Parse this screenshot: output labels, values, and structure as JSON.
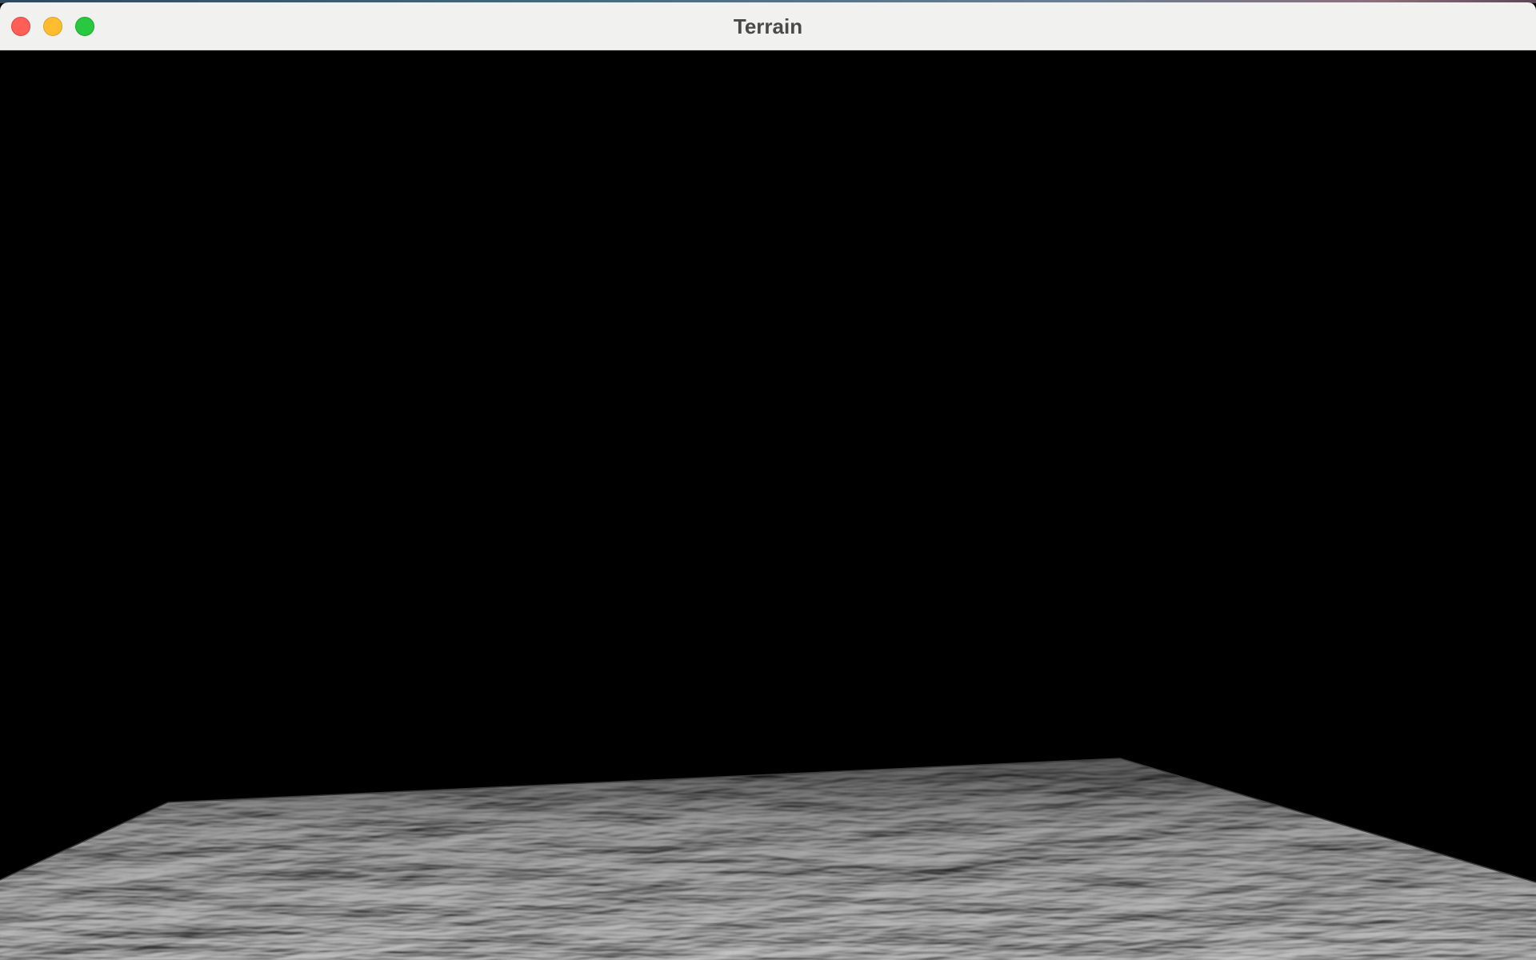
{
  "window": {
    "title": "Terrain",
    "controls": {
      "close": "close-button",
      "minimize": "minimize-button",
      "zoom": "zoom-button"
    }
  },
  "colors": {
    "background": "#000000",
    "titlebar": "#f1f1f0",
    "title_text": "#4a4a4a",
    "close": "#ff5f57",
    "minimize": "#febc2e",
    "zoom": "#28c840",
    "terrain_dark": "#1a1a1a",
    "terrain_light": "#9a9a9a"
  }
}
